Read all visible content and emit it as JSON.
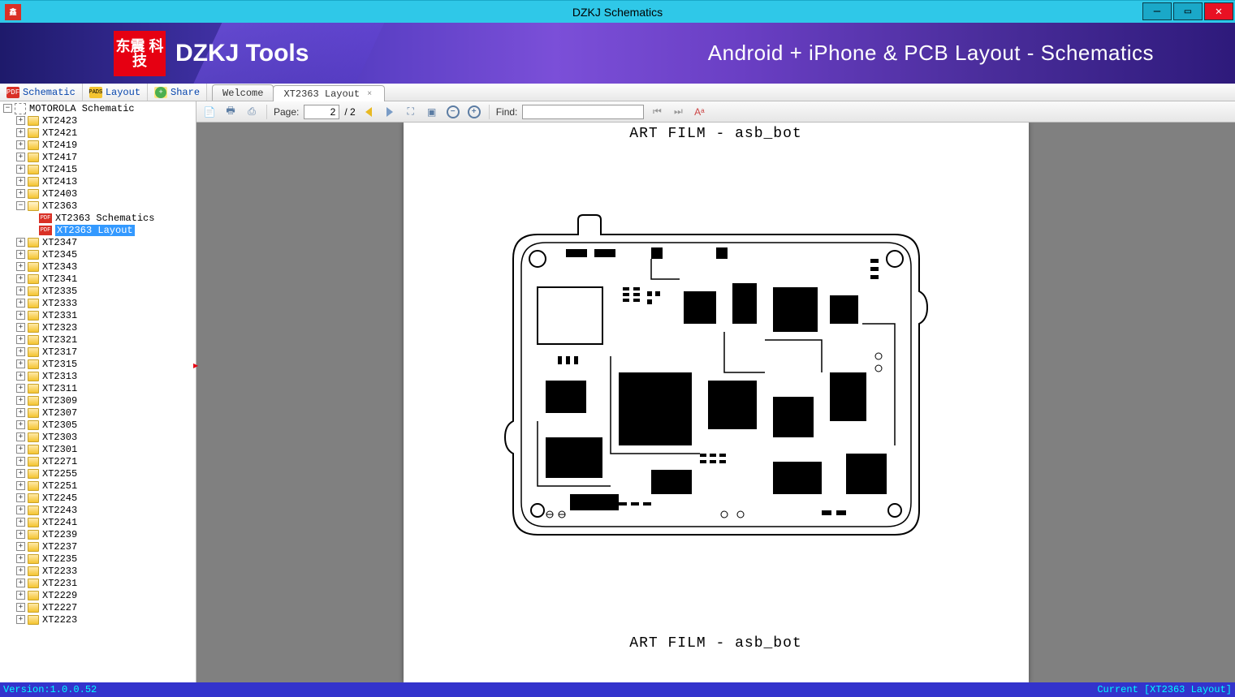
{
  "window": {
    "title": "DZKJ Schematics",
    "app_icon_text": "鑫"
  },
  "banner": {
    "logo_text": "东震\n科技",
    "tool_name": "DZKJ Tools",
    "tagline": "Android + iPhone & PCB Layout - Schematics"
  },
  "nav_tabs": {
    "schematic": "Schematic",
    "layout": "Layout",
    "share": "Share",
    "pdf_badge": "PDF",
    "pads_badge": "PADS"
  },
  "doc_tabs": {
    "welcome": "Welcome",
    "active": "XT2363 Layout"
  },
  "tree": {
    "root": "MOTOROLA Schematic",
    "items_before": [
      "XT2423",
      "XT2421",
      "XT2419",
      "XT2417",
      "XT2415",
      "XT2413",
      "XT2403"
    ],
    "expanded": {
      "name": "XT2363",
      "children": [
        {
          "label": "XT2363 Schematics",
          "selected": false
        },
        {
          "label": "XT2363 Layout",
          "selected": true
        }
      ]
    },
    "items_after": [
      "XT2347",
      "XT2345",
      "XT2343",
      "XT2341",
      "XT2335",
      "XT2333",
      "XT2331",
      "XT2323",
      "XT2321",
      "XT2317",
      "XT2315",
      "XT2313",
      "XT2311",
      "XT2309",
      "XT2307",
      "XT2305",
      "XT2303",
      "XT2301",
      "XT2271",
      "XT2255",
      "XT2251",
      "XT2245",
      "XT2243",
      "XT2241",
      "XT2239",
      "XT2237",
      "XT2235",
      "XT2233",
      "XT2231",
      "XT2229",
      "XT2227",
      "XT2223"
    ]
  },
  "toolbar": {
    "page_label": "Page:",
    "page_value": "2",
    "page_total": "/ 2",
    "find_label": "Find:",
    "find_value": ""
  },
  "document": {
    "title_top": "ART FILM - asb_bot",
    "title_bottom": "ART FILM - asb_bot"
  },
  "statusbar": {
    "version": "Version:1.0.0.52",
    "current": "Current [XT2363 Layout]"
  }
}
